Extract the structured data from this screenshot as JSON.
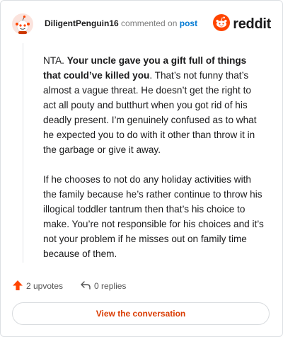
{
  "header": {
    "username": "DiligentPenguin16",
    "action_text": "commented on",
    "post_link": "post",
    "brand": "reddit"
  },
  "comment": {
    "p1_prefix": "NTA. ",
    "p1_bold": "Your uncle gave you a gift full of things that could’ve killed you",
    "p1_rest": ". That’s not funny that’s almost a vague threat. He doesn’t get the right to act all pouty and butthurt when you got rid of his deadly present. I’m genuinely confused as to what he expected you to do with it other than throw it in the garbage or give it away.",
    "p2": "If he chooses to not do any holiday activities with the family because he’s rather continue to throw his illogical toddler tantrum then that’s his choice to make. You’re not responsible for his choices and it’s not your problem if he misses out on family time because of them."
  },
  "footer": {
    "upvotes": "2 upvotes",
    "replies": "0 replies"
  },
  "cta": {
    "label": "View the conversation"
  },
  "colors": {
    "brand": "#ff4500",
    "link": "#0079d3",
    "cta_text": "#d93a00"
  },
  "icons": {
    "avatar": "snoo-avatar-icon",
    "logo": "reddit-logo-icon",
    "upvote": "upvote-arrow-icon",
    "reply": "reply-arrow-icon"
  }
}
